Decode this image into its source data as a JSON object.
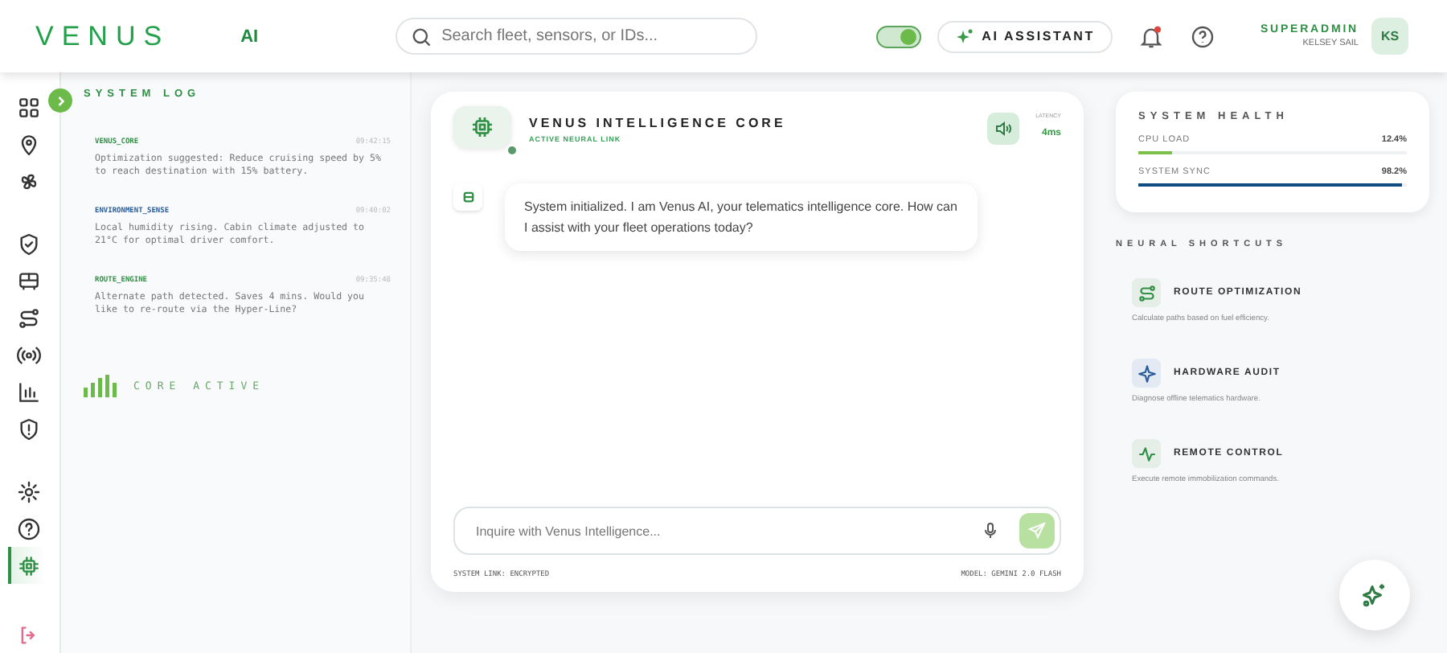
{
  "header": {
    "logo": "VENUS",
    "badge": "AI",
    "search": {
      "placeholder": "Search fleet, sensors, or IDs..."
    },
    "toggle": {
      "on": true
    },
    "assistant_button": "AI ASSISTANT",
    "notifications": {
      "unread": true
    },
    "user": {
      "role": "SUPERADMIN",
      "name": "KELSEY SAIL",
      "initials": "KS"
    }
  },
  "sidebar": {
    "groups": [
      [
        {
          "selected": false
        },
        {
          "selected": false
        },
        {
          "selected": false
        }
      ],
      [
        {
          "selected": false
        },
        {
          "selected": false
        },
        {
          "selected": false
        },
        {
          "selected": false
        },
        {
          "selected": false
        },
        {
          "selected": false
        }
      ],
      [
        {
          "selected": false
        },
        {
          "selected": false
        },
        {
          "selected": true
        }
      ]
    ]
  },
  "system_log": {
    "title": "SYSTEM LOG",
    "entries": [
      {
        "source": "VENUS_CORE",
        "time": "09:42:15",
        "message": "Optimization suggested: Reduce cruising speed by 5% to reach destination with 15% battery."
      },
      {
        "source": "ENVIRONMENT_SENSE",
        "time": "09:40:02",
        "message": "Local humidity rising. Cabin climate adjusted to 21°C for optimal driver comfort."
      },
      {
        "source": "ROUTE_ENGINE",
        "time": "09:35:48",
        "message": "Alternate path detected. Saves 4 mins. Would you like to re-route via the Hyper-Line?"
      }
    ],
    "status": "CORE ACTIVE"
  },
  "chat": {
    "title": "VENUS INTELLIGENCE CORE",
    "subtitle": "ACTIVE NEURAL LINK",
    "online": true,
    "latency_label": "LATENCY",
    "latency": "4ms",
    "messages": [
      {
        "text": "System initialized. I am Venus AI, your telematics intelligence core. How can I assist with your fleet operations today?"
      }
    ],
    "input": {
      "placeholder": "Inquire with Venus Intelligence..."
    },
    "footer_left": "SYSTEM LINK: ENCRYPTED",
    "footer_right": "MODEL: GEMINI 2.0 FLASH"
  },
  "system_health": {
    "title": "SYSTEM HEALTH",
    "metrics": [
      {
        "label": "CPU LOAD",
        "value": "12.4%",
        "level": 0.124,
        "color": "#7cc04a"
      },
      {
        "label": "SYSTEM SYNC",
        "value": "98.2%",
        "level": 0.982,
        "color": "#0f4c81"
      }
    ]
  },
  "shortcuts": {
    "title": "NEURAL SHORTCUTS",
    "items": [
      {
        "kind": "route",
        "title": "ROUTE OPTIMIZATION",
        "description": "Calculate paths based on fuel efficiency."
      },
      {
        "kind": "audit",
        "title": "HARDWARE AUDIT",
        "description": "Diagnose offline telematics hardware."
      },
      {
        "kind": "remote",
        "title": "REMOTE CONTROL",
        "description": "Execute remote immobilization commands."
      }
    ]
  }
}
